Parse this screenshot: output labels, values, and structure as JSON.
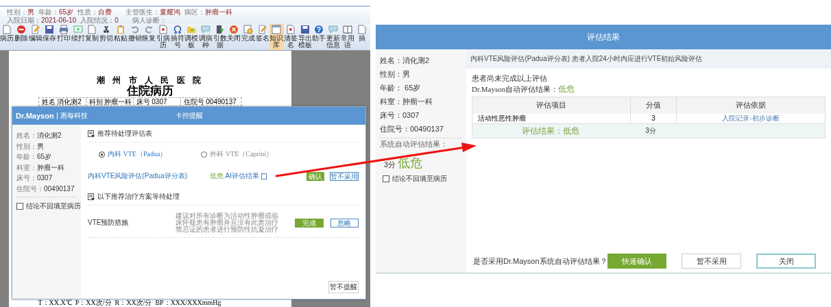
{
  "left_screen": {
    "header": {
      "rows": [
        {
          "fields": [
            {
              "label": "性别：",
              "value": "男"
            },
            {
              "label": "年龄：",
              "value": "65岁"
            },
            {
              "label": "性质：",
              "value": "自费"
            },
            {
              "label": "主管医生：",
              "value": "董耀鸿"
            },
            {
              "label": "病区：",
              "value": "肿瘤一科"
            }
          ]
        },
        {
          "fields": [
            {
              "label": "入院日期：",
              "value": "2021-06-10"
            },
            {
              "label": "入院情况：",
              "value": "0"
            },
            {
              "label": "病人诊断："
            }
          ]
        }
      ]
    },
    "toolbar": [
      {
        "label": "病历",
        "selected": false
      },
      {
        "label": "删除",
        "selected": false
      },
      {
        "label": "编辑",
        "selected": false
      },
      {
        "label": "保存",
        "selected": false
      },
      {
        "label": "打印",
        "selected": false
      },
      {
        "label": "续打",
        "selected": false
      },
      {
        "label": "复制",
        "selected": false
      },
      {
        "label": "剪切",
        "selected": false
      },
      {
        "label": "粘贴",
        "selected": false
      },
      {
        "label": "撤销",
        "selected": false
      },
      {
        "label": "恢复",
        "selected": false
      },
      {
        "label": "引病历",
        "selected": false
      },
      {
        "label": "插符号",
        "selected": false
      },
      {
        "label": "调模板",
        "selected": false
      },
      {
        "label": "调病种",
        "selected": false
      },
      {
        "label": "引数据",
        "selected": false
      },
      {
        "label": "关闭",
        "selected": false
      },
      {
        "label": "完成",
        "selected": false
      },
      {
        "label": "签名",
        "selected": false
      },
      {
        "label": "知识库",
        "selected": true
      },
      {
        "label": "清签名",
        "selected": false
      },
      {
        "label": "导出模板",
        "selected": false
      },
      {
        "label": "助手",
        "selected": false
      },
      {
        "label": "更新信息",
        "selected": false
      },
      {
        "label": "常用语",
        "selected": false
      },
      {
        "label": "插",
        "selected": false
      }
    ],
    "document": {
      "hospital": "潮 州 市 人 民 医 院",
      "title": "住院病历",
      "info": [
        {
          "label": "姓名",
          "value": "消化测2"
        },
        {
          "label": "科别",
          "value": "肿瘤一科"
        },
        {
          "label": "床号",
          "value": "0307"
        },
        {
          "label": "住院号",
          "value": "00490137"
        }
      ],
      "vitals": "T：XX.X℃  P：XX次/分  R：XX次/分  BP：XXX/XXXmmHg"
    },
    "dialog": {
      "brand": "Dr.Mayson",
      "company": "惠每科技",
      "title": "卡控提醒",
      "patient": [
        {
          "label": "姓名：",
          "value": "消化测2"
        },
        {
          "label": "性别：",
          "value": "男"
        },
        {
          "label": "年龄：",
          "value": "65岁"
        },
        {
          "label": "科室：",
          "value": "肿瘤一科"
        },
        {
          "label": "床号：",
          "value": "0307"
        },
        {
          "label": "住院号：",
          "value": "00490137"
        }
      ],
      "no_backfill": {
        "label": "结论不回填至病历",
        "checked": false
      },
      "assessment_section": {
        "title": "推荐待处理评估表",
        "options": [
          {
            "label": "内科 VTE（Padua）",
            "selected": true
          },
          {
            "label": "外科 VTE（Caprini）",
            "selected": false
          }
        ],
        "item": {
          "name": "内科VTE风险评估(Padua评分表)",
          "risk": "低危",
          "result_link": "AI评估结果",
          "buttons": [
            {
              "label": "确认",
              "kind": "primary"
            },
            {
              "label": "暂不采用",
              "kind": "secondary"
            }
          ]
        }
      },
      "treatment_section": {
        "title": "以下推荐治疗方案等待处理",
        "item": {
          "name": "VTE预防措施",
          "description": "建议对所有诊断为活动性肿瘤或临床怀疑患有肿瘤并且没有此类治疗禁忌证的患者进行预防性抗凝治疗",
          "buttons": [
            {
              "label": "完成",
              "kind": "primary"
            },
            {
              "label": "忽略",
              "kind": "secondary"
            }
          ]
        }
      },
      "dismiss_button": "暂不提醒"
    }
  },
  "right_screen": {
    "dialog": {
      "title": "评估结果",
      "patient": [
        {
          "label": "姓名：",
          "value": "消化测2"
        },
        {
          "label": "性别：",
          "value": "男"
        },
        {
          "label": "年龄：",
          "value": " 65岁"
        },
        {
          "label": "科室：",
          "value": "肿瘤一科"
        },
        {
          "label": "床号：",
          "value": "0307"
        },
        {
          "label": "住院号：",
          "value": "00490137"
        }
      ],
      "auto_result_label": "系统自动评估结果：",
      "auto_score": "3分",
      "auto_risk": "低危",
      "no_backfill": {
        "label": "结论不回填至病历",
        "checked": false
      },
      "subheader": "内科VTE风险评估(Padua评分表) 患者入院24小时内应进行VTE初始风险评估",
      "status": "患者尚未完成以上评估",
      "result_label": "Dr.Mayson自动评估结果：",
      "result_risk": "低危",
      "table": {
        "columns": [
          "评估项目",
          "分值",
          "评估依据"
        ],
        "rows": [
          {
            "item": "活动性恶性肿瘤",
            "score": "3",
            "basis": "入院记录-初步诊断"
          }
        ],
        "summary": {
          "result": "评估结果：低危",
          "score": "3分"
        }
      },
      "question": "是否采用Dr.Mayson系统自动评估结果？",
      "buttons": [
        {
          "label": "快速确认",
          "kind": "primary"
        },
        {
          "label": "暂不采用",
          "kind": "secondary"
        },
        {
          "label": "关闭",
          "kind": "outline"
        }
      ]
    }
  }
}
